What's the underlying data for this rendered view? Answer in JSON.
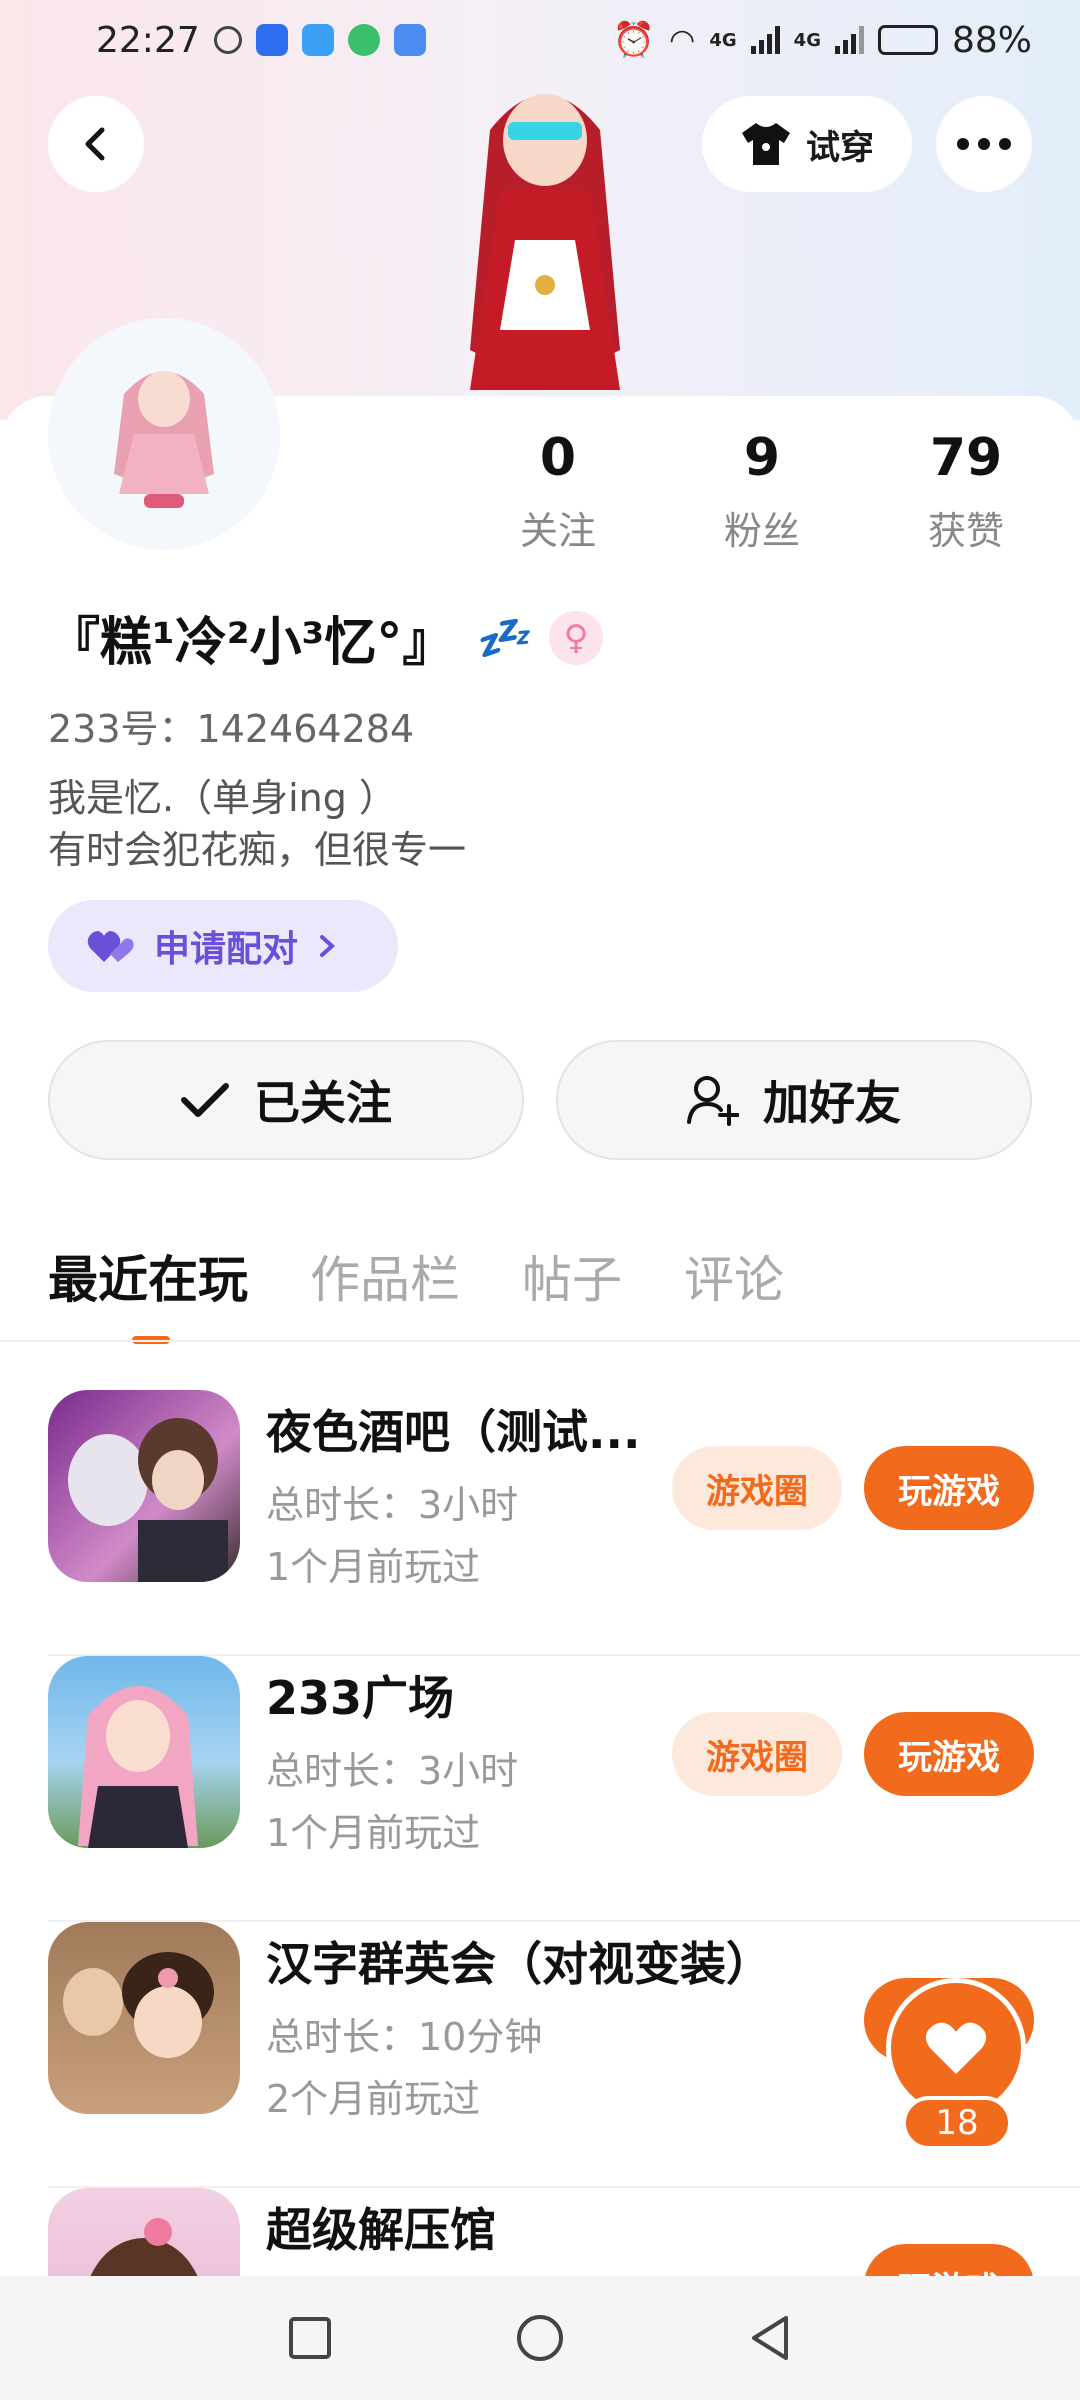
{
  "status_bar": {
    "time": "22:27",
    "battery": "88%",
    "battery_level": 0.88,
    "network_a": "4G",
    "network_b": "4G"
  },
  "top_bar": {
    "back_icon": "back-arrow-icon",
    "tryon_label": "试穿",
    "more_icon": "more-dots-icon"
  },
  "profile": {
    "stats": [
      {
        "value": "0",
        "label": "关注"
      },
      {
        "value": "9",
        "label": "粉丝"
      },
      {
        "value": "79",
        "label": "获赞"
      }
    ],
    "nickname": "『糕¹冷²小³忆°』",
    "status_emoji": "💤",
    "gender_symbol": "♀",
    "uid": "233号：142464284",
    "bio_line1": "我是忆.（单身ing ）",
    "bio_line2": "有时会犯花痴，但很专一",
    "pair_label": "申请配对"
  },
  "actions": {
    "followed_label": "已关注",
    "add_friend_label": "加好友"
  },
  "tabs": [
    "最近在玩",
    "作品栏",
    "帖子",
    "评论"
  ],
  "games": [
    {
      "title": "夜色酒吧（测试...",
      "duration": "总时长：3小时",
      "last_played": "1个月前玩过",
      "circle_label": "游戏圈",
      "play_label": "玩游戏"
    },
    {
      "title": "233广场",
      "duration": "总时长：3小时",
      "last_played": "1个月前玩过",
      "circle_label": "游戏圈",
      "play_label": "玩游戏"
    },
    {
      "title": "汉字群英会（对视变装）",
      "duration": "总时长：10分钟",
      "last_played": "2个月前玩过",
      "play_label": "玩游戏"
    },
    {
      "title": "超级解压馆",
      "play_label": "玩游戏"
    }
  ],
  "like_badge": {
    "count": "18"
  },
  "colors": {
    "accent": "#f26b1d",
    "pair_purple": "#6a4fd9"
  }
}
